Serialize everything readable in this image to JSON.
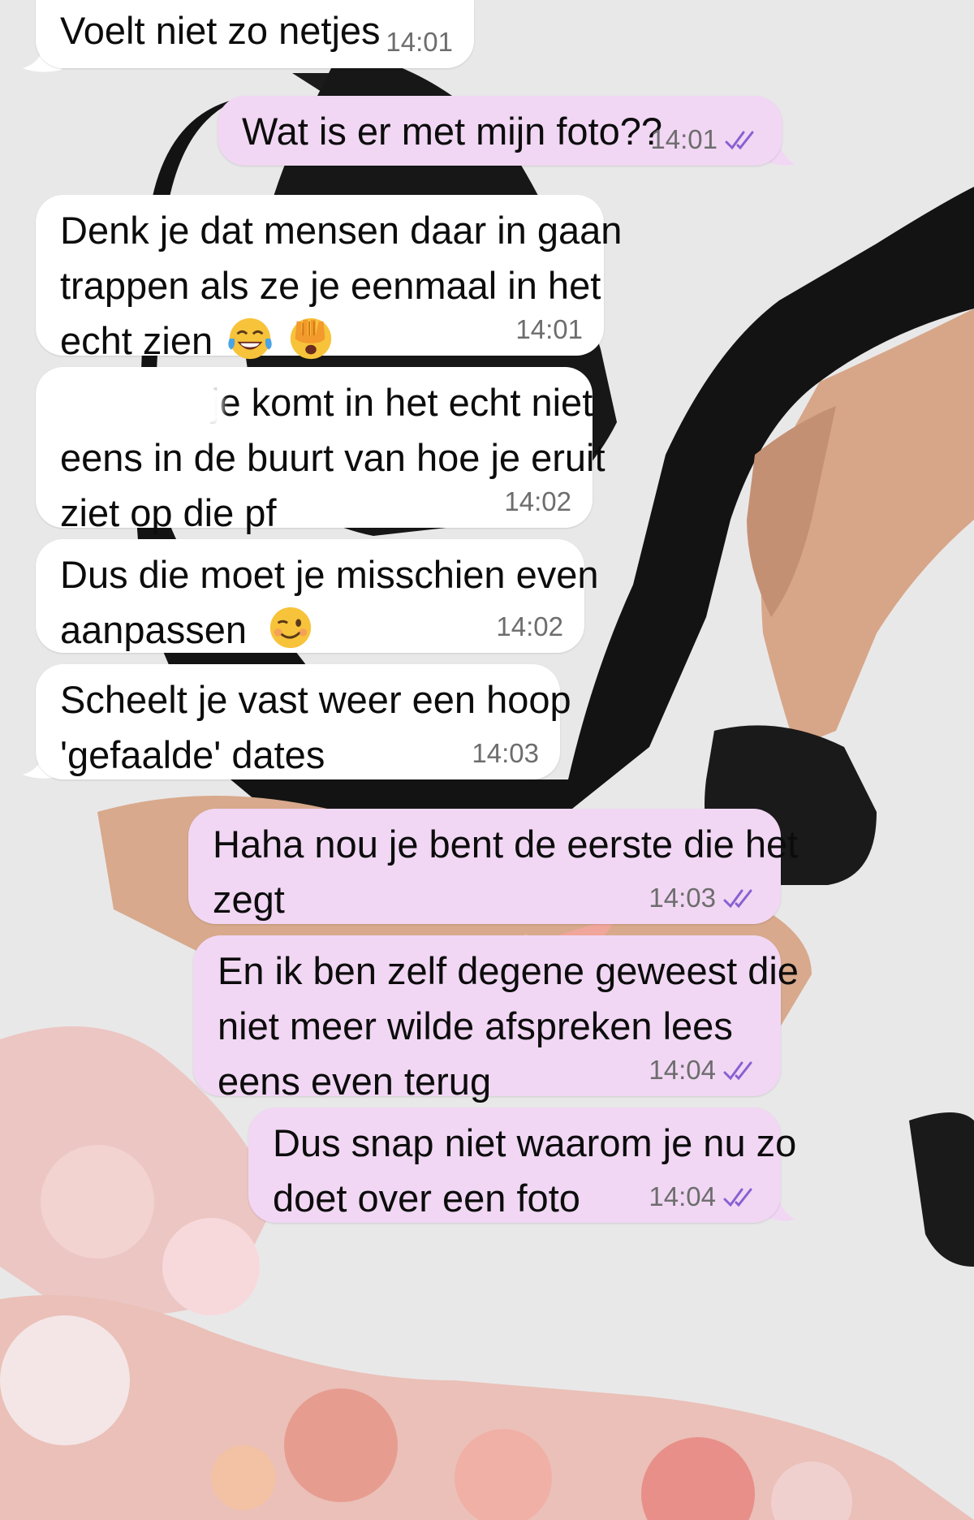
{
  "chat": {
    "messages": [
      {
        "id": "m1",
        "direction": "incoming",
        "lines": [
          "Voelt niet zo netjes"
        ],
        "time": "14:01"
      },
      {
        "id": "m2",
        "direction": "outgoing",
        "lines": [
          "Wat is er met mijn foto??"
        ],
        "time": "14:01",
        "status": "read"
      },
      {
        "id": "m3",
        "direction": "incoming",
        "lines": [
          "Denk je dat mensen daar in gaan",
          "trappen als ze je eenmaal in het",
          "echt zien"
        ],
        "emojis": [
          "tears-of-joy-emoji",
          "face-with-hand-over-eyes-emoji"
        ],
        "time": "14:01"
      },
      {
        "id": "m4",
        "direction": "incoming",
        "lines": [
          "je komt in het echt niet",
          "eens in de buurt van hoe je eruit",
          "ziet op die pf"
        ],
        "time": "14:02",
        "partially_redacted": true
      },
      {
        "id": "m5",
        "direction": "incoming",
        "lines": [
          "Dus die moet je misschien even",
          "aanpassen"
        ],
        "emojis": [
          "winking-face-emoji"
        ],
        "time": "14:02"
      },
      {
        "id": "m6",
        "direction": "incoming",
        "lines": [
          "Scheelt je vast weer een hoop",
          "'gefaalde' dates"
        ],
        "time": "14:03"
      },
      {
        "id": "m7",
        "direction": "outgoing",
        "lines": [
          "Haha nou je bent de eerste die het",
          "zegt"
        ],
        "time": "14:03",
        "status": "read"
      },
      {
        "id": "m8",
        "direction": "outgoing",
        "lines": [
          "En ik ben zelf degene geweest die",
          "niet meer wilde afspreken lees",
          "eens even terug"
        ],
        "time": "14:04",
        "status": "read"
      },
      {
        "id": "m9",
        "direction": "outgoing",
        "lines": [
          "Dus snap niet waarom je nu zo",
          "doet over een foto"
        ],
        "time": "14:04",
        "status": "read"
      }
    ]
  },
  "colors": {
    "incoming_bubble": "#ffffff",
    "outgoing_bubble": "#f1d7f4",
    "read_ticks": "#8b5fd1",
    "timestamp": "#6d6d6d",
    "background": "#e9e7e8"
  },
  "icons": {
    "read_receipt": "double-check-icon"
  }
}
